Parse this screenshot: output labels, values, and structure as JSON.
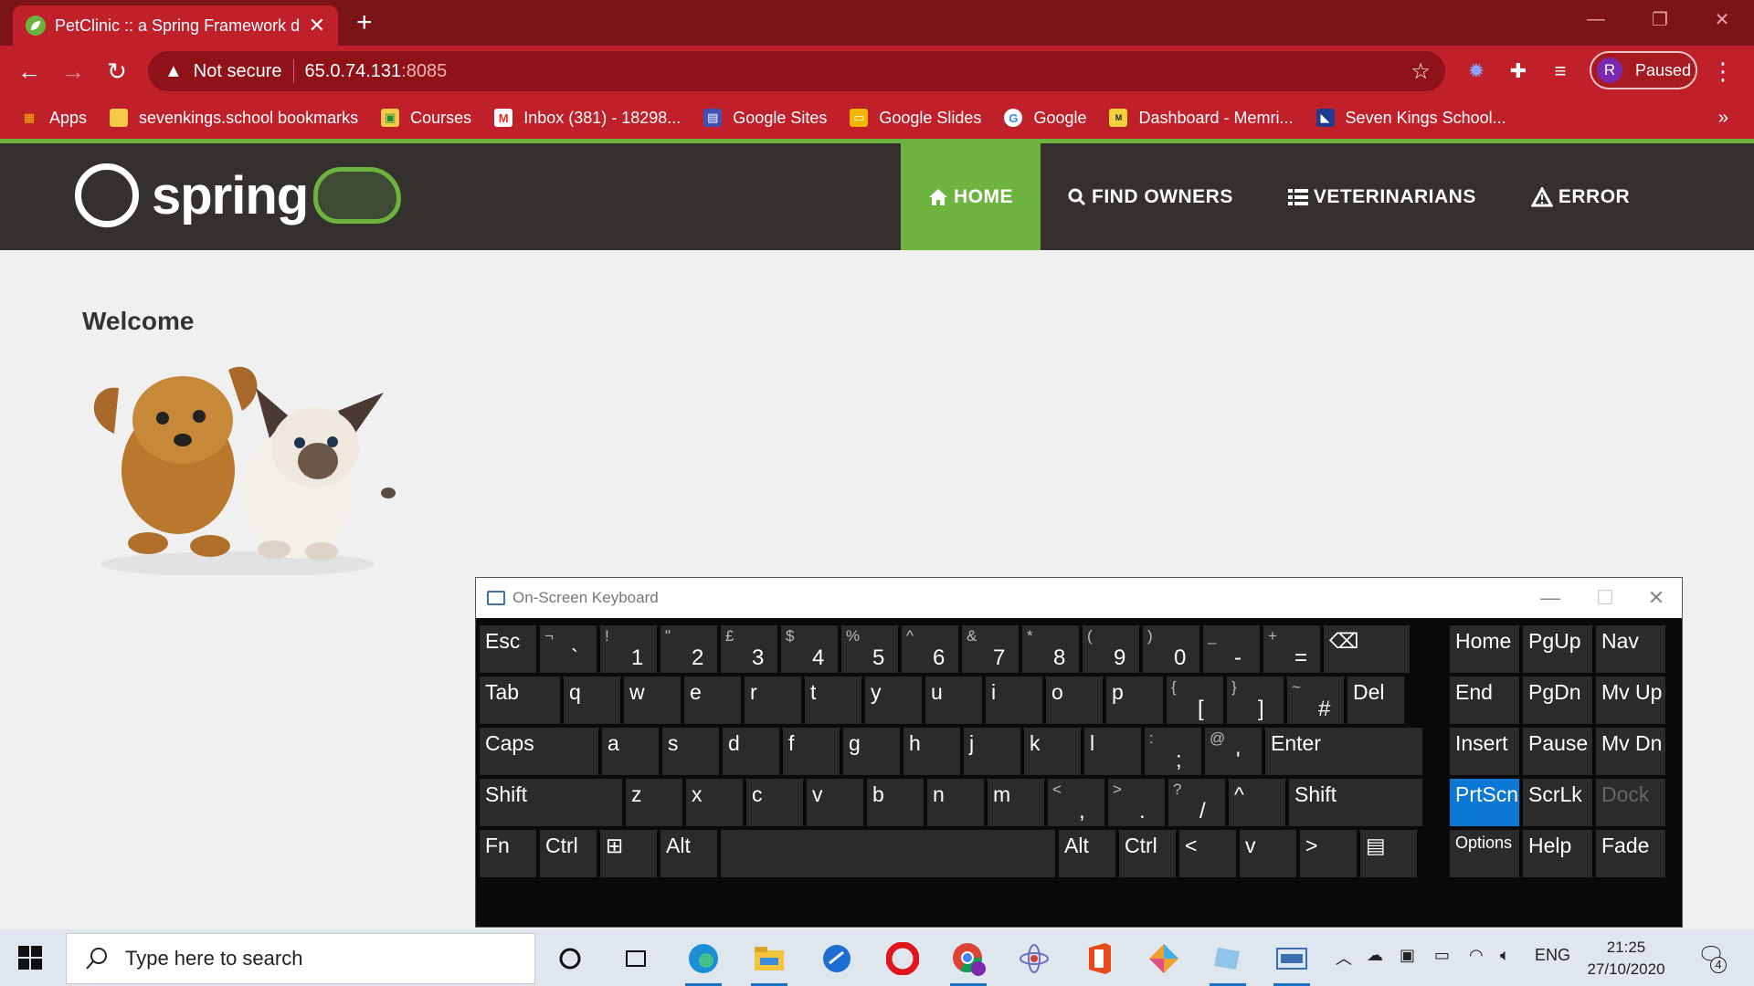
{
  "browser": {
    "tab_title": "PetClinic :: a Spring Framework d",
    "tab_close": "✕",
    "new_tab": "+",
    "security_label": "Not secure",
    "url_host": "65.0.74.131",
    "url_port": ":8085",
    "profile_initial": "R",
    "profile_status": "Paused",
    "accent_color": "#c0202a"
  },
  "bookmarks": [
    {
      "label": "Apps",
      "icon": "apps-grid-icon"
    },
    {
      "label": "sevenkings.school bookmarks",
      "icon": "folder-icon"
    },
    {
      "label": "Courses",
      "icon": "classroom-icon"
    },
    {
      "label": "Inbox (381) - 18298...",
      "icon": "gmail-icon"
    },
    {
      "label": "Google Sites",
      "icon": "google-sites-icon"
    },
    {
      "label": "Google Slides",
      "icon": "google-slides-icon"
    },
    {
      "label": "Google",
      "icon": "google-icon"
    },
    {
      "label": "Dashboard - Memri...",
      "icon": "memrise-icon"
    },
    {
      "label": "Seven Kings School...",
      "icon": "school-icon"
    }
  ],
  "site": {
    "logo_text": "spring",
    "nav": [
      {
        "label": "HOME",
        "icon": "home-icon",
        "active": true
      },
      {
        "label": "FIND OWNERS",
        "icon": "search-icon",
        "active": false
      },
      {
        "label": "VETERINARIANS",
        "icon": "list-icon",
        "active": false
      },
      {
        "label": "ERROR",
        "icon": "warning-icon",
        "active": false
      }
    ],
    "heading": "Welcome",
    "brand_color": "#6db33f",
    "navbar_color": "#34302d"
  },
  "osk": {
    "title": "On-Screen Keyboard",
    "rows": [
      [
        {
          "k": "Esc"
        },
        {
          "s": "¬",
          "m": "`"
        },
        {
          "s": "!",
          "m": "1"
        },
        {
          "s": "\"",
          "m": "2"
        },
        {
          "s": "£",
          "m": "3"
        },
        {
          "s": "$",
          "m": "4"
        },
        {
          "s": "%",
          "m": "5"
        },
        {
          "s": "^",
          "m": "6"
        },
        {
          "s": "&",
          "m": "7"
        },
        {
          "s": "*",
          "m": "8"
        },
        {
          "s": "(",
          "m": "9"
        },
        {
          "s": ")",
          "m": "0"
        },
        {
          "s": "_",
          "m": "-"
        },
        {
          "s": "+",
          "m": "="
        },
        {
          "k": "⌫"
        },
        {
          "k": "Home"
        },
        {
          "k": "PgUp"
        },
        {
          "k": "Nav"
        }
      ],
      [
        {
          "k": "Tab"
        },
        {
          "k": "q"
        },
        {
          "k": "w"
        },
        {
          "k": "e"
        },
        {
          "k": "r"
        },
        {
          "k": "t"
        },
        {
          "k": "y"
        },
        {
          "k": "u"
        },
        {
          "k": "i"
        },
        {
          "k": "o"
        },
        {
          "k": "p"
        },
        {
          "s": "{",
          "m": "["
        },
        {
          "s": "}",
          "m": "]"
        },
        {
          "s": "~",
          "m": "#"
        },
        {
          "k": "Del"
        },
        {
          "k": "End"
        },
        {
          "k": "PgDn"
        },
        {
          "k": "Mv Up"
        }
      ],
      [
        {
          "k": "Caps"
        },
        {
          "k": "a"
        },
        {
          "k": "s"
        },
        {
          "k": "d"
        },
        {
          "k": "f"
        },
        {
          "k": "g"
        },
        {
          "k": "h"
        },
        {
          "k": "j"
        },
        {
          "k": "k"
        },
        {
          "k": "l"
        },
        {
          "s": ":",
          "m": ";"
        },
        {
          "s": "@",
          "m": "'"
        },
        {
          "k": "Enter"
        },
        {
          "k": "Insert"
        },
        {
          "k": "Pause"
        },
        {
          "k": "Mv Dn"
        }
      ],
      [
        {
          "k": "Shift"
        },
        {
          "k": "z"
        },
        {
          "k": "x"
        },
        {
          "k": "c"
        },
        {
          "k": "v"
        },
        {
          "k": "b"
        },
        {
          "k": "n"
        },
        {
          "k": "m"
        },
        {
          "s": "<",
          "m": ","
        },
        {
          "s": ">",
          "m": "."
        },
        {
          "s": "?",
          "m": "/"
        },
        {
          "k": "^"
        },
        {
          "k": "Shift"
        },
        {
          "k": "PrtScn"
        },
        {
          "k": "ScrLk"
        },
        {
          "k": "Dock"
        }
      ],
      [
        {
          "k": "Fn"
        },
        {
          "k": "Ctrl"
        },
        {
          "k": "⊞"
        },
        {
          "k": "Alt"
        },
        {
          "k": ""
        },
        {
          "k": "Alt"
        },
        {
          "k": "Ctrl"
        },
        {
          "k": "<"
        },
        {
          "k": "v"
        },
        {
          "k": ">"
        },
        {
          "k": "▤"
        },
        {
          "k": "Options"
        },
        {
          "k": "Help"
        },
        {
          "k": "Fade"
        }
      ]
    ]
  },
  "taskbar": {
    "search_placeholder": "Type here to search",
    "language": "ENG",
    "time": "21:25",
    "date": "27/10/2020",
    "notification_count": "4"
  }
}
